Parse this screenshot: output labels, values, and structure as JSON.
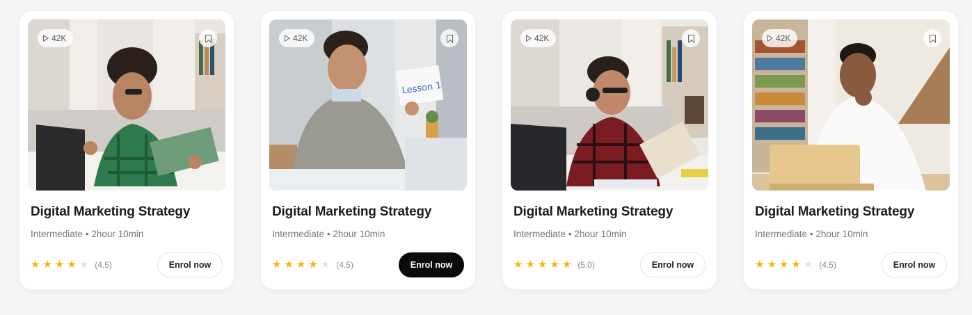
{
  "courses": [
    {
      "views": "42K",
      "title": "Digital Marketing Strategy",
      "level": "Intermediate",
      "separator": "•",
      "duration": "2hour 10min",
      "stars_filled": 4,
      "rating": "(4.5)",
      "cta": "Enrol now",
      "cta_style": "outline",
      "photo": "student with headphones, laptop and tablet"
    },
    {
      "views": "42K",
      "title": "Digital Marketing Strategy",
      "level": "Intermediate",
      "separator": "•",
      "duration": "2hour 10min",
      "stars_filled": 4,
      "rating": "(4.5)",
      "cta": "Enrol now",
      "cta_style": "filled",
      "photo": "tutor holding Lesson 1 card"
    },
    {
      "views": "42K",
      "title": "Digital Marketing Strategy",
      "level": "Intermediate",
      "separator": "•",
      "duration": "2hour 10min",
      "stars_filled": 5,
      "rating": "(5.0)",
      "cta": "Enrol now",
      "cta_style": "outline",
      "photo": "student with headset reading notebook"
    },
    {
      "views": "42K",
      "title": "Digital Marketing Strategy",
      "level": "Intermediate",
      "separator": "•",
      "duration": "2hour 10min",
      "stars_filled": 4,
      "rating": "(4.5)",
      "cta": "Enrol now",
      "cta_style": "outline",
      "photo": "man in library studying at laptop"
    }
  ],
  "thumb_text": {
    "lesson_card": "Lesson 1"
  },
  "colors": {
    "star": "#f7b500",
    "star_empty": "#e0e0e0",
    "cta_dark": "#0b0b0b"
  },
  "icons": {
    "views": "play-icon",
    "save": "bookmark-icon",
    "rating": "star-icon"
  }
}
